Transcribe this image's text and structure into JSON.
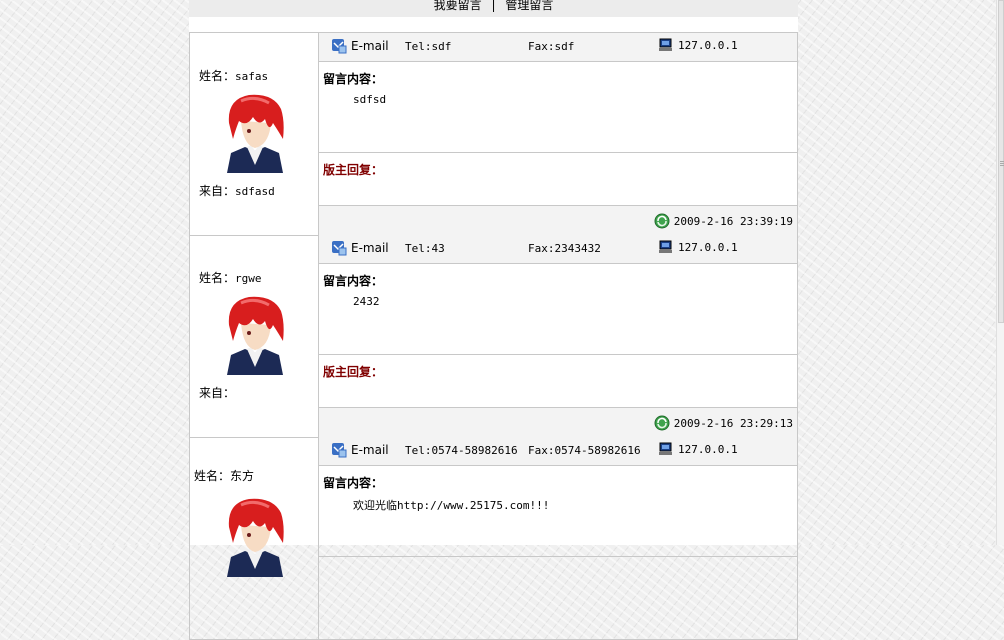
{
  "nav": {
    "write_label": "我要留言",
    "separator": "|",
    "manage_label": "管理留言"
  },
  "labels": {
    "name_prefix": "姓名：",
    "from_prefix": "来自：",
    "email_label": "E-mail",
    "content_heading": "留言内容：",
    "reply_heading": "版主回复："
  },
  "entries": [
    {
      "name": "safas",
      "from": "sdfasd",
      "tel": "Tel:sdf",
      "fax": "Fax:sdf",
      "ip": "127.0.0.1",
      "content": "sdfsd",
      "reply": "",
      "time": "2009-2-16 23:39:19"
    },
    {
      "name": "rgwe",
      "from": "",
      "tel": "Tel:43",
      "fax": "Fax:2343432",
      "ip": "127.0.0.1",
      "content": "2432",
      "reply": "",
      "time": "2009-2-16 23:29:13"
    },
    {
      "name": "东方",
      "from": "",
      "tel": "Tel:0574-58982616",
      "fax": "Fax:0574-58982616",
      "ip": "127.0.0.1",
      "content": "欢迎光临http://www.25175.com!!!",
      "reply": "",
      "time": ""
    }
  ],
  "icons": {
    "mail": "mail-icon",
    "ip": "computer-icon",
    "time": "clock-refresh-icon",
    "avatar": "anime-avatar-red-hair"
  },
  "colors": {
    "reply_heading": "#800000",
    "border": "#c8c8c8",
    "info_bg": "#f3f3f3"
  }
}
